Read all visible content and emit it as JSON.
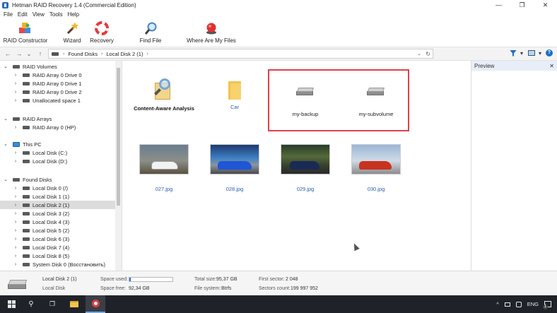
{
  "window": {
    "title": "Hetman RAID Recovery 1.4 (Commercial Edition)",
    "minimize": "—",
    "maximize": "❐",
    "close": "✕"
  },
  "menu": [
    "File",
    "Edit",
    "View",
    "Tools",
    "Help"
  ],
  "toolbar": {
    "raid_constructor": "RAID Constructor",
    "wizard": "Wizard",
    "recovery": "Recovery",
    "find_file": "Find File",
    "where_are_my_files": "Where Are My Files"
  },
  "address": {
    "back": "←",
    "forward": "→",
    "dropdown": "⌄",
    "up": "↑",
    "segments": [
      "Found Disks",
      "Local Disk 2 (1)"
    ],
    "separator": "›",
    "dd": "⌄",
    "refresh": "↻"
  },
  "right_tools": {
    "dd": "▾",
    "dd2": "▾",
    "help": "?"
  },
  "tree": {
    "raid_volumes": {
      "label": "RAID Volumes",
      "items": [
        "RAID Array 0 Drive 0",
        "RAID Array 0 Drive 1",
        "RAID Array 0 Drive 2",
        "Unallocated space 1"
      ]
    },
    "raid_arrays": {
      "label": "RAID Arrays",
      "items": [
        "RAID Array 0 (HP)"
      ]
    },
    "this_pc": {
      "label": "This PC",
      "items": [
        "Local Disk (C:)",
        "Local Disk (D:)"
      ]
    },
    "found_disks": {
      "label": "Found Disks",
      "items": [
        "Local Disk 0 (/)",
        "Local Disk 1 (1)",
        "Local Disk 2 (1)",
        "Local Disk 3 (2)",
        "Local Disk 4 (3)",
        "Local Disk 5 (2)",
        "Local Disk 6 (3)",
        "Local Disk 7 (4)",
        "Local Disk 8 (5)",
        "System Disk 0 (Восстановить)"
      ],
      "selected_index": 2
    },
    "expanded_chevron": "⌄",
    "collapsed_chevron": "›"
  },
  "content": {
    "items": [
      {
        "label": "Content-Aware Analysis",
        "icon": "magnifier-icon"
      },
      {
        "label": "Car",
        "icon": "folder-icon"
      },
      {
        "label": "my-backup",
        "icon": "disk-icon"
      },
      {
        "label": "my-subvolume",
        "icon": "disk-icon"
      }
    ],
    "images": [
      {
        "label": "027.jpg"
      },
      {
        "label": "028.jpg"
      },
      {
        "label": "029.jpg"
      },
      {
        "label": "030.jpg"
      }
    ],
    "highlight_color": "#e0414a"
  },
  "preview": {
    "title": "Preview",
    "close": "✕"
  },
  "status": {
    "disk_name": "Local Disk 2 (1)",
    "disk_type": "Local Disk",
    "space_used_label": "Space used:",
    "space_used_fraction": 0.03,
    "space_free_label": "Space free:",
    "space_free_value": "92,34 GB",
    "total_size_label": "Total size:",
    "total_size_value": "95,37 GB",
    "file_system_label": "File system:",
    "file_system_value": "Btrfs",
    "first_sector_label": "First sector:",
    "first_sector_value": "2 048",
    "sectors_count_label": "Sectors count:",
    "sectors_count_value": "199 997 952"
  },
  "taskbar": {
    "search": "⚲",
    "task_view": "❐",
    "lang": "ENG",
    "tray_arrow": "^",
    "notification_count": "1"
  }
}
